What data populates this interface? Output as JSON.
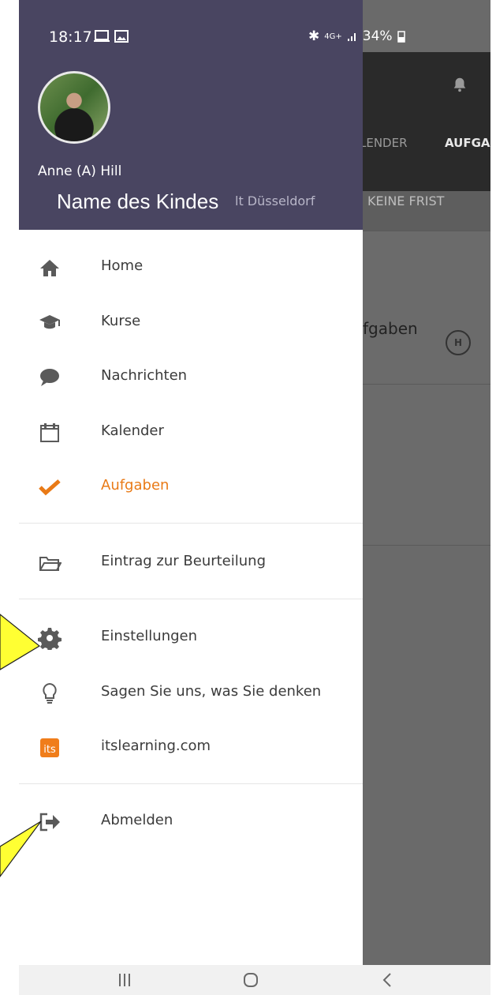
{
  "status": {
    "time": "18:17",
    "network": "4G+",
    "battery": "34%"
  },
  "user": {
    "name": "Anne (A) Hill",
    "school": "lt Düsseldorf"
  },
  "annotation": {
    "child_label": "Name des Kindes"
  },
  "menu": {
    "primary": [
      {
        "label": "Home",
        "icon": "home-icon"
      },
      {
        "label": "Kurse",
        "icon": "graduation-cap-icon"
      },
      {
        "label": "Nachrichten",
        "icon": "chat-bubble-icon"
      },
      {
        "label": "Kalender",
        "icon": "calendar-icon"
      },
      {
        "label": "Aufgaben",
        "icon": "checkmark-icon",
        "active": true
      }
    ],
    "secondary": [
      {
        "label": "Eintrag zur Beurteilung",
        "icon": "folder-icon"
      }
    ],
    "tertiary": [
      {
        "label": "Einstellungen",
        "icon": "gear-icon"
      },
      {
        "label": "Sagen Sie uns, was Sie denken",
        "icon": "lightbulb-icon"
      },
      {
        "label": "itslearning.com",
        "icon": "itslearning-logo-icon"
      }
    ],
    "logout": {
      "label": "Abmelden",
      "icon": "logout-icon"
    }
  },
  "background_app": {
    "tabs": [
      "LENDER",
      "AUFGA"
    ],
    "filter": "KEINE FRIST",
    "row_text": "fgaben",
    "row_badge": "H"
  },
  "colors": {
    "header": "#494561",
    "active": "#e97a16",
    "callout": "#ffff33"
  }
}
